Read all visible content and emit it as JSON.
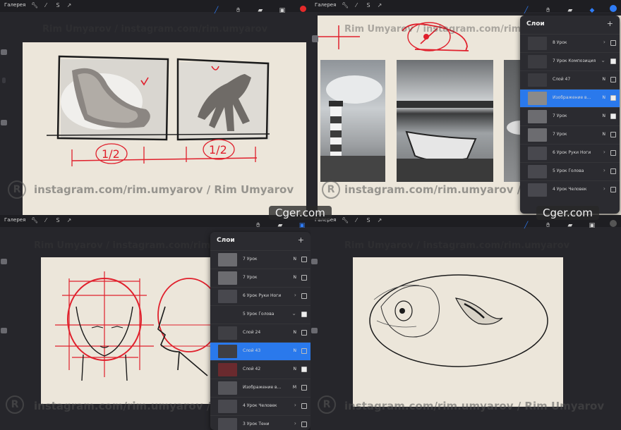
{
  "watermark_url": "instagram.com/rim.umyarov / Rim Umyarov",
  "watermark_name": "Rim Umyarov",
  "watermark_top": "Rim Umyarov / instagram.com/rim.umyarov",
  "cger_badge": "Cger.com",
  "q1": {
    "gallery": "Галерея",
    "sketch_fraction_left": "1/2",
    "sketch_fraction_right": "1/2"
  },
  "q2": {
    "gallery": "Галерея",
    "layers_panel": {
      "title": "Слои",
      "add": "+",
      "rows": [
        {
          "name": "8 Урок",
          "type": "group"
        },
        {
          "name": "7 Урок Композиция",
          "type": "group"
        },
        {
          "name": "Слой 47",
          "mode": "N"
        },
        {
          "name": "Изображение в...",
          "mode": "N",
          "selected": true
        },
        {
          "name": "7 Урок",
          "mode": "N"
        },
        {
          "name": "7 Урок",
          "mode": "N"
        },
        {
          "name": "6 Урок Руки Ноги",
          "type": "group"
        },
        {
          "name": "5 Урок Голова",
          "type": "group"
        },
        {
          "name": "4 Урок Человек",
          "type": "group"
        }
      ]
    }
  },
  "q3": {
    "gallery": "Галерея",
    "layers_panel": {
      "title": "Слои",
      "add": "+",
      "rows": [
        {
          "name": "7 Урок",
          "mode": "N"
        },
        {
          "name": "7 Урок",
          "mode": "N"
        },
        {
          "name": "6 Урок Руки Ноги",
          "type": "group"
        },
        {
          "name": "5 Урок Голова",
          "type": "group"
        },
        {
          "name": "Слой 24",
          "mode": "N"
        },
        {
          "name": "Слой 43",
          "mode": "N",
          "selected": true
        },
        {
          "name": "Слой 42",
          "mode": "N"
        },
        {
          "name": "Изображение в...",
          "mode": "M"
        },
        {
          "name": "4 Урок Человек",
          "type": "group"
        },
        {
          "name": "3 Урок Тени",
          "type": "group"
        }
      ]
    }
  },
  "q4": {
    "gallery": "Галерея"
  },
  "colors": {
    "accent": "#2a79ec",
    "sketch_red": "#e0202c",
    "paper": "#ece6da",
    "ui_dark": "#1e1e22"
  },
  "icons": [
    "wrench-icon",
    "magic-wand-icon",
    "selection-s-icon",
    "transform-arrow-icon",
    "brush-icon",
    "smudge-icon",
    "eraser-icon",
    "layers-icon",
    "color-dot-icon"
  ]
}
